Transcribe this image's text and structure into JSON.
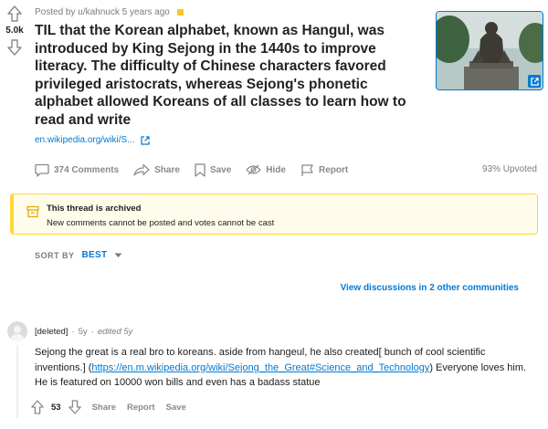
{
  "post": {
    "score": "5.0k",
    "posted_by": "Posted by u/kahnuck 5 years ago",
    "title": "TIL that the Korean alphabet, known as Hangul, was introduced by King Sejong in the 1440s to improve literacy. The difficulty of Chinese characters favored privileged aristocrats, whereas Sejong's phonetic alphabet allowed Koreans of all classes to learn how to read and write",
    "link_text": "en.wikipedia.org/wiki/S..."
  },
  "actions": {
    "comments": "374 Comments",
    "share": "Share",
    "save": "Save",
    "hide": "Hide",
    "report": "Report",
    "upvoted": "93% Upvoted"
  },
  "archived": {
    "heading": "This thread is archived",
    "subtext": "New comments cannot be posted and votes cannot be cast"
  },
  "sort": {
    "label": "SORT BY",
    "value": "BEST"
  },
  "other_discussions": "View discussions in 2 other communities",
  "comment": {
    "user": "[deleted]",
    "sep": "·",
    "age": "5y",
    "edited": "edited 5y",
    "text_before": "Sejong the great is a real bro to koreans. aside from hangeul, he also created[ bunch of cool scientific inventions.] (",
    "link": "https://en.m.wikipedia.org/wiki/Sejong_the_Great#Science_and_Technology",
    "text_after": ") Everyone loves him. He is featured on 10000 won bills and even has a badass statue",
    "score": "53",
    "share": "Share",
    "report": "Report",
    "save": "Save"
  },
  "colors": {
    "accent": "#0079d3",
    "archived_border": "#ffd635",
    "muted": "#878a8c"
  },
  "icons": [
    "upvote-icon",
    "downvote-icon",
    "external-link-icon",
    "comment-icon",
    "share-icon",
    "save-icon",
    "hide-icon",
    "report-icon",
    "archive-icon",
    "chevron-down-icon"
  ]
}
